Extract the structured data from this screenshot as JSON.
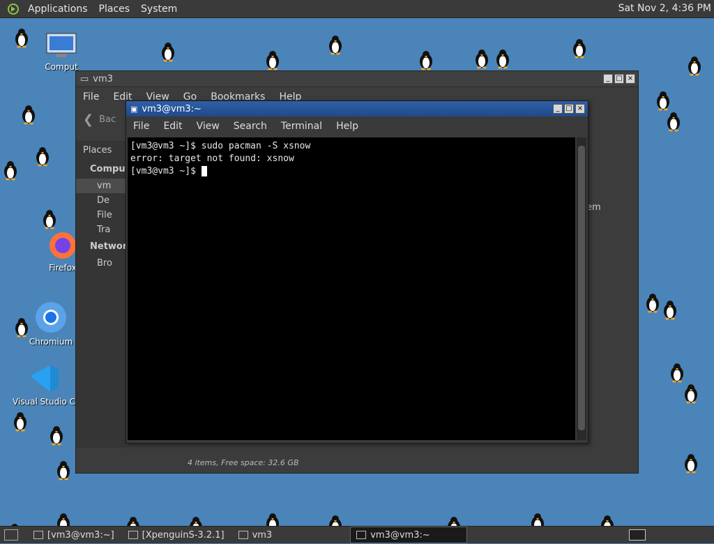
{
  "top_panel": {
    "menus": [
      "Applications",
      "Places",
      "System"
    ],
    "clock": "Sat Nov 2,  4:36 PM"
  },
  "desktop_icons": [
    {
      "label": "Comput"
    },
    {
      "label": "Firefox"
    },
    {
      "label": "Chromium"
    },
    {
      "label": "Visual Studio C"
    }
  ],
  "file_manager": {
    "title": "vm3",
    "menus": [
      "File",
      "Edit",
      "View",
      "Go",
      "Bookmarks",
      "Help"
    ],
    "back_label": "Bac",
    "sidebar": {
      "header": "Places",
      "computer_group": "Comput",
      "items": [
        "vm",
        "De",
        "File",
        "Tra"
      ],
      "network_group": "Network",
      "network_items": [
        "Bro"
      ]
    },
    "right_label": "em",
    "status": "4 items, Free space: 32.6 GB"
  },
  "terminal": {
    "title": "vm3@vm3:~",
    "menus": [
      "File",
      "Edit",
      "View",
      "Search",
      "Terminal",
      "Help"
    ],
    "lines": [
      "[vm3@vm3 ~]$ sudo pacman -S xsnow",
      "error: target not found: xsnow",
      "[vm3@vm3 ~]$ "
    ]
  },
  "taskbar": {
    "tasks": [
      "[vm3@vm3:~]",
      "[XpenguinS-3.2.1]",
      "vm3",
      "vm3@vm3:~"
    ]
  }
}
